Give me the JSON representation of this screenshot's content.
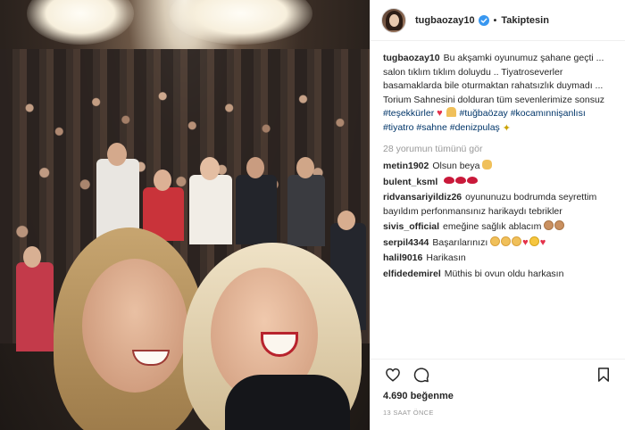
{
  "header": {
    "username": "tugbaozay10",
    "separator": "•",
    "follow_label": "Takiptesin"
  },
  "caption": {
    "username": "tugbaozay10",
    "text": "Bu akşamki oyunumuz şahane geçti ... salon tıklım tıklım doluydu .. Tiyatroseverler basamaklarda bile oturmaktan rahatsızlık duymadı ... Torium Sahnesini dolduran tüm sevenlerimize sonsuz",
    "tag_thanks": "#teşekkürler",
    "tag_tugba": "#tuğbaözay",
    "tag_kocam": "#kocamınnişanlısı",
    "tag_tiyatro": "#tiyatro",
    "tag_sahne": "#sahne",
    "tag_deniz": "#denizpulaş"
  },
  "view_comments": "28 yorumun tümünü gör",
  "comments": [
    {
      "username": "metin1902",
      "text": "Olsun beya"
    },
    {
      "username": "bulent_ksml",
      "text": ""
    },
    {
      "username": "ridvansariyildiz26",
      "text": "oyununuzu bodrumda seyrettim bayıldım perfonmansınız harikaydı tebrikler"
    },
    {
      "username": "sivis_official",
      "text": "emeğine sağlık ablacım"
    },
    {
      "username": "serpil4344",
      "text": "Başarılarınızı"
    },
    {
      "username": "halil9016",
      "text": "Harikasın"
    },
    {
      "username": "elfidedemirel",
      "text": "Müthiş bi oyun oldu harkasın"
    }
  ],
  "likes": "4.690 beğenme",
  "timestamp": "13 SAAT ÖNCE",
  "icons": {
    "verified": "verified-badge-icon",
    "like": "heart-icon",
    "comment": "speech-bubble-icon",
    "save": "bookmark-icon"
  },
  "colors": {
    "verified_blue": "#3897f0",
    "hashtag": "#003569",
    "muted": "#999999",
    "text": "#262626"
  }
}
